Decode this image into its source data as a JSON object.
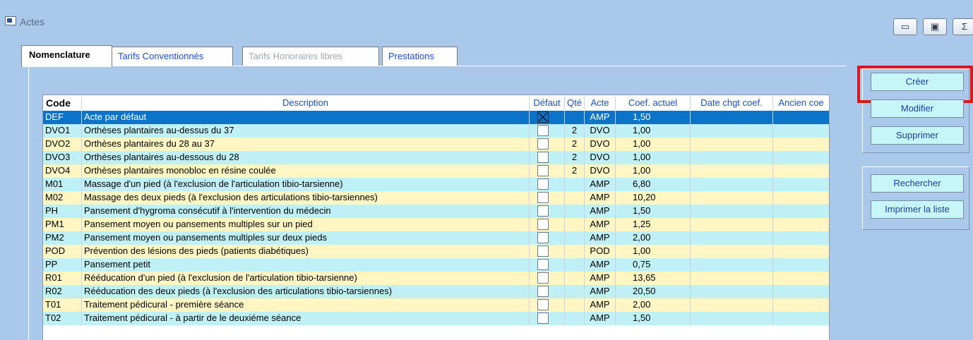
{
  "window": {
    "title": "Actes",
    "controls": {
      "minimize": "▭",
      "maximize": "▣",
      "close": "Σ"
    }
  },
  "tabs": [
    {
      "label": "Nomenclature",
      "state": "active"
    },
    {
      "label": "Tarifs Conventionnés",
      "state": "normal"
    },
    {
      "label": "Tarifs Honoraires libres",
      "state": "disabled"
    },
    {
      "label": "Prestations",
      "state": "normal"
    }
  ],
  "table": {
    "columns": [
      "Code",
      "Description",
      "Défaut",
      "Qté",
      "Acte",
      "Coef. actuel",
      "Date chgt coef.",
      "Ancien coe"
    ],
    "rows": [
      {
        "code": "DEF",
        "description": "Acte par défaut",
        "default": true,
        "qty": "",
        "acte": "AMP",
        "coef": "1,50",
        "date": "",
        "old": "",
        "style": "selected"
      },
      {
        "code": "DVO1",
        "description": "Orthèses plantaires au-dessus du 37",
        "default": false,
        "qty": "2",
        "acte": "DVO",
        "coef": "1,00",
        "date": "",
        "old": "",
        "style": "blue"
      },
      {
        "code": "DVO2",
        "description": "Orthèses plantaires du 28 au 37",
        "default": false,
        "qty": "2",
        "acte": "DVO",
        "coef": "1,00",
        "date": "",
        "old": "",
        "style": "yellow"
      },
      {
        "code": "DVO3",
        "description": "Orthèses plantaires au-dessous du 28",
        "default": false,
        "qty": "2",
        "acte": "DVO",
        "coef": "1,00",
        "date": "",
        "old": "",
        "style": "blue"
      },
      {
        "code": "DVO4",
        "description": "Orthèses plantaires monobloc en résine coulée",
        "default": false,
        "qty": "2",
        "acte": "DVO",
        "coef": "1,00",
        "date": "",
        "old": "",
        "style": "yellow"
      },
      {
        "code": "M01",
        "description": "Massage d'un pied (à l'exclusion de l'articulation tibio-tarsienne)",
        "default": false,
        "qty": "",
        "acte": "AMP",
        "coef": "6,80",
        "date": "",
        "old": "",
        "style": "blue"
      },
      {
        "code": "M02",
        "description": "Massage des deux pieds (à l'exclusion des articulations tibio-tarsiennes)",
        "default": false,
        "qty": "",
        "acte": "AMP",
        "coef": "10,20",
        "date": "",
        "old": "",
        "style": "yellow"
      },
      {
        "code": "PH",
        "description": "Pansement d'hygroma consécutif à l'intervention du médecin",
        "default": false,
        "qty": "",
        "acte": "AMP",
        "coef": "1,50",
        "date": "",
        "old": "",
        "style": "blue"
      },
      {
        "code": "PM1",
        "description": "Pansement moyen ou pansements multiples sur un pied",
        "default": false,
        "qty": "",
        "acte": "AMP",
        "coef": "1,25",
        "date": "",
        "old": "",
        "style": "yellow"
      },
      {
        "code": "PM2",
        "description": "Pansement moyen ou pansements multiples sur deux pieds",
        "default": false,
        "qty": "",
        "acte": "AMP",
        "coef": "2,00",
        "date": "",
        "old": "",
        "style": "blue"
      },
      {
        "code": "POD",
        "description": "Prévention des lésions des pieds (patients diabétiques)",
        "default": false,
        "qty": "",
        "acte": "POD",
        "coef": "1,00",
        "date": "",
        "old": "",
        "style": "yellow"
      },
      {
        "code": "PP",
        "description": "Pansement petit",
        "default": false,
        "qty": "",
        "acte": "AMP",
        "coef": "0,75",
        "date": "",
        "old": "",
        "style": "blue"
      },
      {
        "code": "R01",
        "description": "Rééducation d'un pied (à l'exclusion de l'articulation tibio-tarsienne)",
        "default": false,
        "qty": "",
        "acte": "AMP",
        "coef": "13,65",
        "date": "",
        "old": "",
        "style": "yellow"
      },
      {
        "code": "R02",
        "description": "Rééducation des deux pieds (à l'exclusion des articulations tibio-tarsiennes)",
        "default": false,
        "qty": "",
        "acte": "AMP",
        "coef": "20,50",
        "date": "",
        "old": "",
        "style": "blue"
      },
      {
        "code": "T01",
        "description": "Traitement pédicural - première séance",
        "default": false,
        "qty": "",
        "acte": "AMP",
        "coef": "2,00",
        "date": "",
        "old": "",
        "style": "yellow"
      },
      {
        "code": "T02",
        "description": "Traitement pédicural - à partir de le deuxiéme séance",
        "default": false,
        "qty": "",
        "acte": "AMP",
        "coef": "1,50",
        "date": "",
        "old": "",
        "style": "blue"
      }
    ]
  },
  "buttons": {
    "create": "Créer",
    "modify": "Modifier",
    "delete": "Supprimer",
    "search": "Rechercher",
    "print": "Imprimer la liste"
  },
  "colors": {
    "window_bg": "#a9c8ea",
    "row_blue": "#bff0f5",
    "row_yellow": "#fff6c3",
    "row_selected": "#0b73c8",
    "highlight": "#e0141c"
  }
}
